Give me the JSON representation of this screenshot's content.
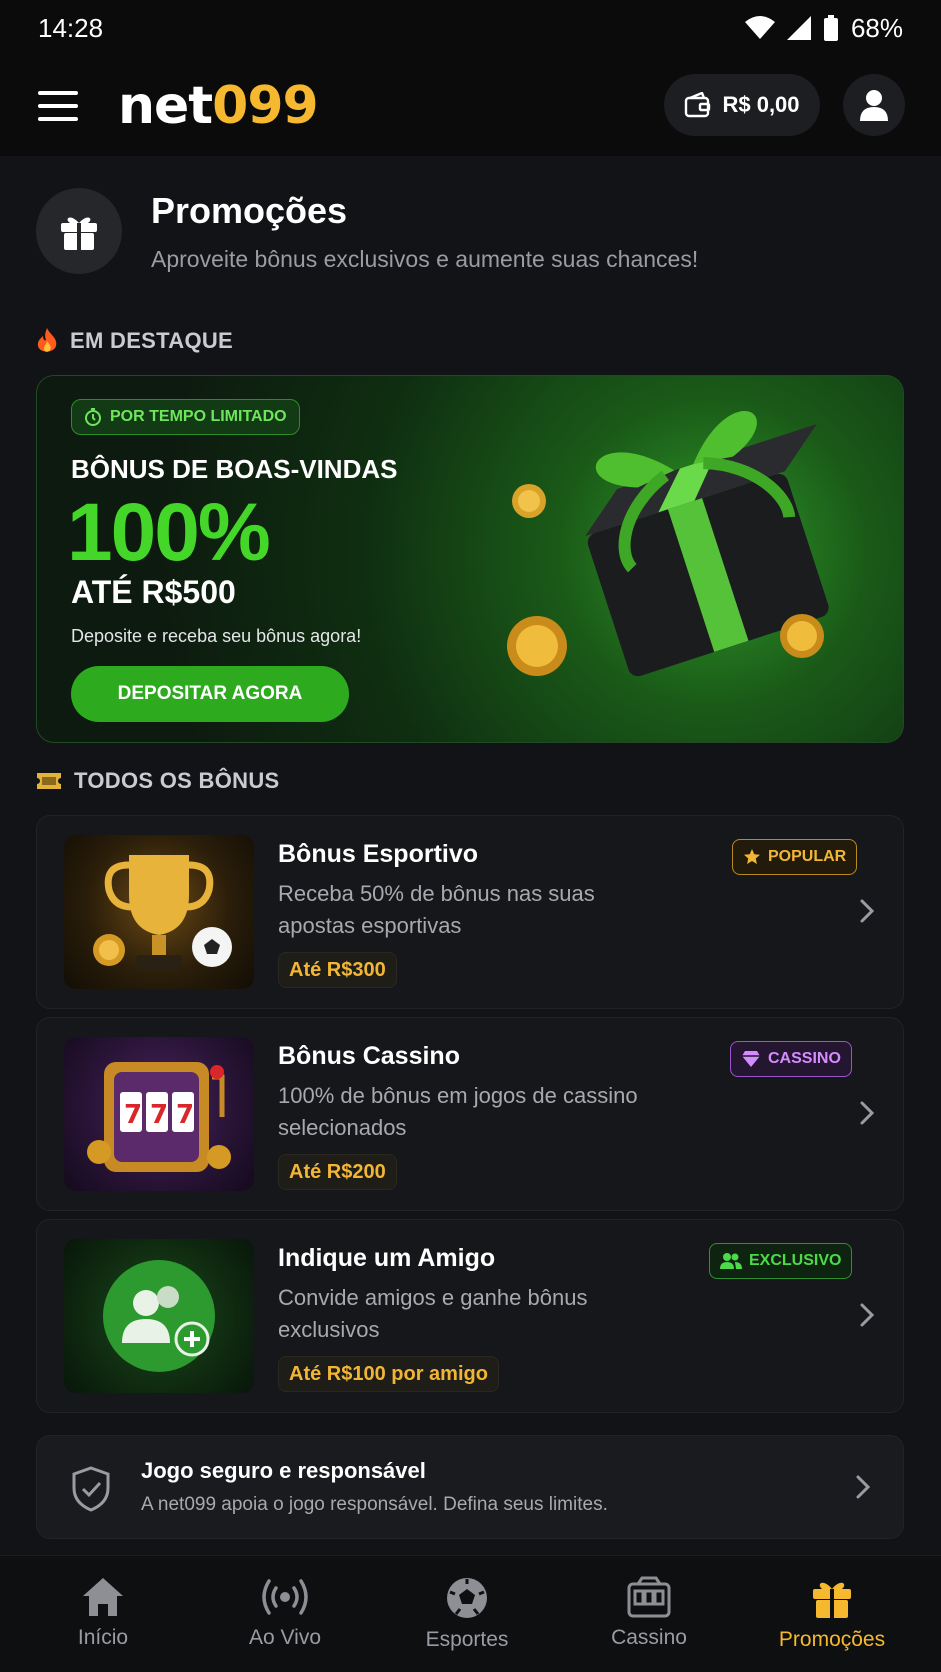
{
  "status_bar": {
    "time": "14:28",
    "battery": "68%"
  },
  "header": {
    "logo_part1": "net",
    "logo_part2": "099",
    "balance": "R$ 0,00"
  },
  "page": {
    "title": "Promoções",
    "subtitle": "Aproveite bônus exclusivos e aumente suas chances!"
  },
  "featured": {
    "section_label": "EM DESTAQUE",
    "badge": "POR TEMPO LIMITADO",
    "title": "BÔNUS DE BOAS-VINDAS",
    "percent": "100%",
    "upto": "ATÉ R$500",
    "description": "Deposite e receba seu bônus agora!",
    "cta": "DEPOSITAR AGORA"
  },
  "bonuses": {
    "section_label": "TODOS OS BÔNUS",
    "items": [
      {
        "title": "Bônus Esportivo",
        "description": "Receba 50% de bônus nas suas apostas esportivas",
        "amount": "Até R$300",
        "tag": "POPULAR",
        "tag_color": "#f2b636"
      },
      {
        "title": "Bônus Cassino",
        "description": "100% de bônus em jogos de cassino selecionados",
        "amount": "Até R$200",
        "tag": "CASSINO",
        "tag_color": "#d58cff"
      },
      {
        "title": "Indique um Amigo",
        "description": "Convide amigos e ganhe bônus exclusivos",
        "amount": "Até R$100 por amigo",
        "tag": "EXCLUSIVO",
        "tag_color": "#4cd94a"
      }
    ]
  },
  "responsible": {
    "title": "Jogo seguro e responsável",
    "description": "A net099 apoia o jogo responsável. Defina seus limites."
  },
  "bottom_nav": [
    {
      "label": "Início",
      "icon": "home-icon"
    },
    {
      "label": "Ao Vivo",
      "icon": "live-icon"
    },
    {
      "label": "Esportes",
      "icon": "soccer-ball-icon"
    },
    {
      "label": "Cassino",
      "icon": "slot-machine-icon"
    },
    {
      "label": "Promoções",
      "icon": "gift-icon",
      "active": true
    }
  ],
  "colors": {
    "accent_yellow": "#f5b82e",
    "accent_green": "#45d62a",
    "background": "#121316"
  }
}
